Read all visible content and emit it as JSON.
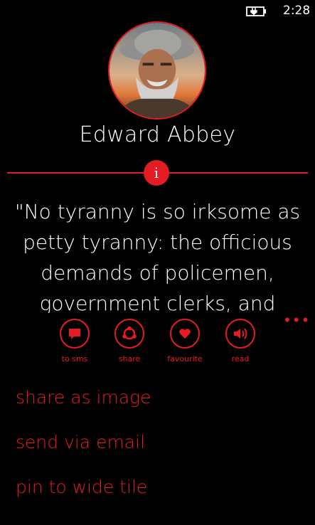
{
  "status": {
    "time": "2:28",
    "battery_icon": "battery-charging-icon"
  },
  "author": {
    "name": "Edward Abbey"
  },
  "quote": {
    "text": "\"No tyranny is so irksome as petty tyranny: the officious demands of policemen, government clerks, and"
  },
  "app_bar": {
    "buttons": [
      {
        "label": "to sms",
        "icon": "message-icon"
      },
      {
        "label": "share",
        "icon": "share-icon"
      },
      {
        "label": "favourite",
        "icon": "heart-icon"
      },
      {
        "label": "read",
        "icon": "speaker-icon"
      }
    ],
    "more_label": "•••"
  },
  "menu": {
    "items": [
      {
        "label": "share as image"
      },
      {
        "label": "send via email"
      },
      {
        "label": "pin to wide tile"
      }
    ]
  },
  "colors": {
    "accent": "#e51c23",
    "background": "#000000",
    "text": "#ffffff"
  }
}
